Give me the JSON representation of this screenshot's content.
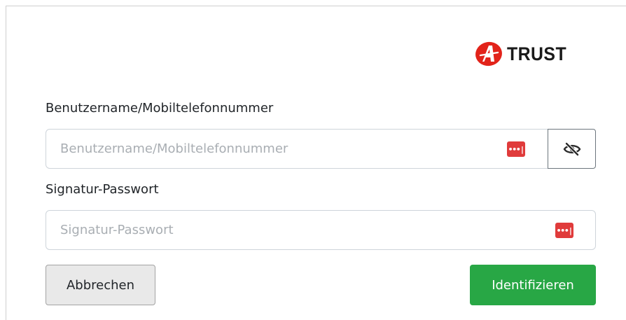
{
  "logo": {
    "text": "TRUST",
    "mark_letter": "A",
    "mark_color": "#e2231a"
  },
  "username": {
    "label": "Benutzername/Mobiltelefonnummer",
    "placeholder": "Benutzername/Mobiltelefonnummer",
    "value": ""
  },
  "password": {
    "label": "Signatur-Passwort",
    "placeholder": "Signatur-Passwort",
    "value": ""
  },
  "password_manager_badge": {
    "glyph": "•••|",
    "color": "#e03b3b"
  },
  "visibility_toggle": {
    "icon": "eye-slash-icon"
  },
  "buttons": {
    "cancel": "Abbrechen",
    "submit": "Identifizieren",
    "submit_color": "#28a745"
  }
}
